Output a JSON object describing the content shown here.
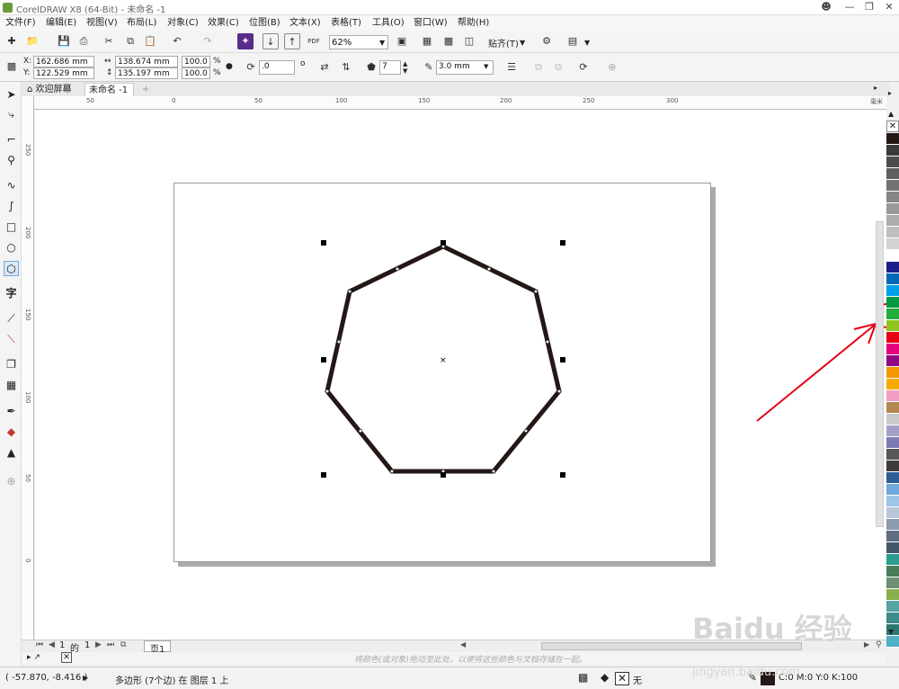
{
  "window": {
    "title": "CorelDRAW X8 (64-Bit) - 未命名 -1",
    "controls": [
      "person-icon",
      "minimize-icon",
      "restore-icon",
      "close-icon"
    ]
  },
  "menu": [
    "文件(F)",
    "编辑(E)",
    "视图(V)",
    "布局(L)",
    "对象(C)",
    "效果(C)",
    "位图(B)",
    "文本(X)",
    "表格(T)",
    "工具(O)",
    "窗口(W)",
    "帮助(H)"
  ],
  "toolbar": {
    "zoom": "62%",
    "snap_label": "贴齐(T)",
    "pdf_label": "PDF"
  },
  "property_bar": {
    "x_label": "X:",
    "x_value": "162.686 mm",
    "y_label": "Y:",
    "y_value": "122.529 mm",
    "width_value": "138.674 mm",
    "height_value": "135.197 mm",
    "scale_x": "100.0",
    "scale_y": "100.0",
    "percent": "%",
    "rotation": ".0",
    "degree": "o",
    "sides": "7",
    "outline_width": "3.0 mm"
  },
  "tabs": {
    "welcome": "欢迎屏幕",
    "document": "未命名 -1",
    "add": "+"
  },
  "ruler": {
    "h_labels": [
      "50",
      "0",
      "50",
      "100",
      "150",
      "200",
      "250",
      "300"
    ],
    "v_labels": [
      "250",
      "200",
      "150",
      "100",
      "50",
      "0"
    ],
    "unit": "毫米"
  },
  "page_nav": {
    "current": "1",
    "of": "的",
    "total": "1",
    "page_tab": "页1"
  },
  "hint": "将颜色(或对象)拖动至此处，以便将这些颜色与文档存储在一起。",
  "status": {
    "coords": "( -57.870, -8.416 )",
    "selection_info": "多边形 (7个边) 在 图层 1 上",
    "fill_none": "无",
    "outline_color": "C:0 M:0 Y:0 K:100"
  },
  "watermark": {
    "brand": "Baidu 经验",
    "url": "jingyan.baidu.com"
  },
  "palette": [
    "#231815",
    "#3a3a3a",
    "#4d4d4d",
    "#606060",
    "#737373",
    "#868686",
    "#999999",
    "#acacac",
    "#bfbfbf",
    "#d2d2d2",
    "#ffffff",
    "#1d2088",
    "#0068b7",
    "#00a0e9",
    "#009944",
    "#22ac38",
    "#8fc31f",
    "#e60012",
    "#e4007f",
    "#920783",
    "#f39800",
    "#f7ab00",
    "#f19ec2",
    "#b28850",
    "#c9caca",
    "#a3a0c8",
    "#7e7bb4",
    "#595757",
    "#3e3a39",
    "#2c5d94",
    "#6fa8dc",
    "#9fc5e8",
    "#b6c7d8",
    "#8b9bab",
    "#5e6f80",
    "#45576a",
    "#2a9d8f",
    "#4a7c59",
    "#6b8f71",
    "#88b04b",
    "#56a3a6",
    "#3d8b8b",
    "#2c7873",
    "#4fb0c6"
  ]
}
